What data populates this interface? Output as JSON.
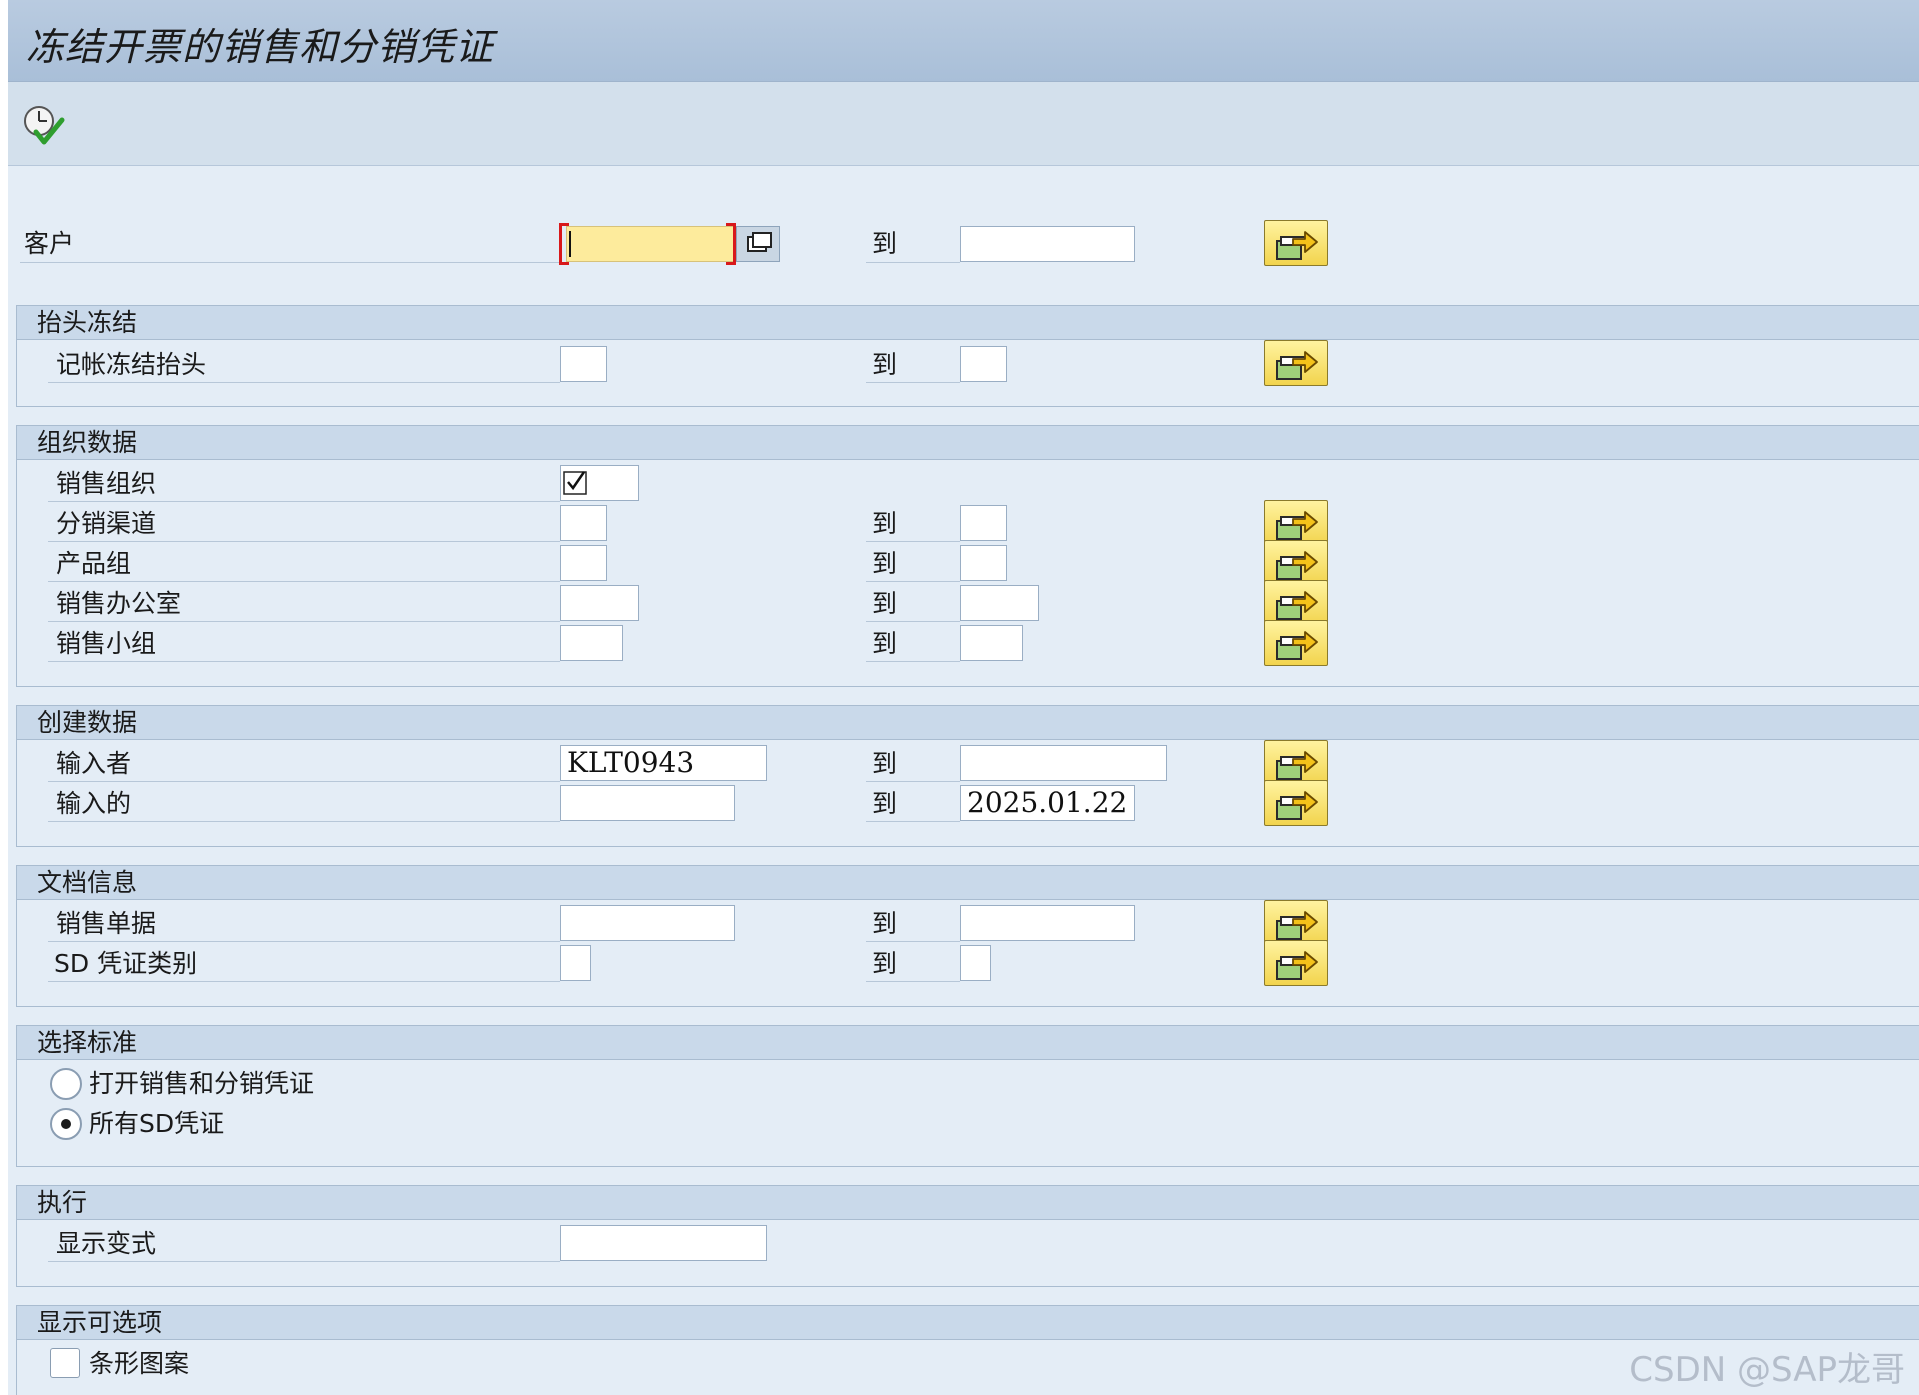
{
  "title": "冻结开票的销售和分销凭证",
  "toolbar": {
    "execute_icon": "execute-clock-icon"
  },
  "to_label": "到",
  "customer": {
    "label": "客户",
    "from": "",
    "to": ""
  },
  "groups": {
    "header_block": {
      "title": "抬头冻结",
      "posting_block": {
        "label": "记帐冻结抬头",
        "from": "",
        "to": ""
      }
    },
    "org": {
      "title": "组织数据",
      "sales_org": {
        "label": "销售组织",
        "checked": true
      },
      "dist_channel": {
        "label": "分销渠道",
        "from": "",
        "to": ""
      },
      "division": {
        "label": "产品组",
        "from": "",
        "to": ""
      },
      "sales_office": {
        "label": "销售办公室",
        "from": "",
        "to": ""
      },
      "sales_group": {
        "label": "销售小组",
        "from": "",
        "to": ""
      }
    },
    "created": {
      "title": "创建数据",
      "entered_by": {
        "label": "输入者",
        "from": "KLT0943",
        "to": ""
      },
      "entered_on": {
        "label": "输入的",
        "from": "",
        "to": "2025.01.22"
      }
    },
    "doc": {
      "title": "文档信息",
      "sales_doc": {
        "label": "销售单据",
        "from": "",
        "to": ""
      },
      "doc_type": {
        "label": "SD 凭证类别",
        "from": "",
        "to": ""
      }
    },
    "criteria": {
      "title": "选择标准",
      "open_docs": {
        "label": "打开销售和分销凭证",
        "selected": false
      },
      "all_docs": {
        "label": "所有SD凭证",
        "selected": true
      }
    },
    "exec": {
      "title": "执行",
      "layout": {
        "label": "显示变式",
        "value": ""
      }
    },
    "options": {
      "title": "显示可选项",
      "bar_chart": {
        "label": "条形图案",
        "checked": false
      }
    }
  },
  "watermark": "CSDN @SAP龙哥"
}
